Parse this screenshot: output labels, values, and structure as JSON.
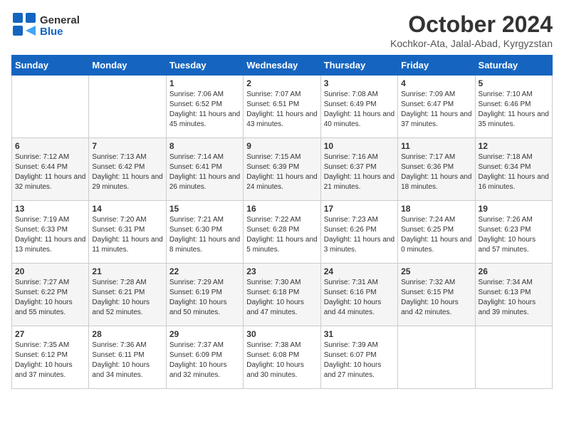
{
  "logo": {
    "text_general": "General",
    "text_blue": "Blue"
  },
  "header": {
    "month": "October 2024",
    "location": "Kochkor-Ata, Jalal-Abad, Kyrgyzstan"
  },
  "days_of_week": [
    "Sunday",
    "Monday",
    "Tuesday",
    "Wednesday",
    "Thursday",
    "Friday",
    "Saturday"
  ],
  "weeks": [
    [
      {
        "day": "",
        "info": ""
      },
      {
        "day": "",
        "info": ""
      },
      {
        "day": "1",
        "info": "Sunrise: 7:06 AM\nSunset: 6:52 PM\nDaylight: 11 hours and 45 minutes."
      },
      {
        "day": "2",
        "info": "Sunrise: 7:07 AM\nSunset: 6:51 PM\nDaylight: 11 hours and 43 minutes."
      },
      {
        "day": "3",
        "info": "Sunrise: 7:08 AM\nSunset: 6:49 PM\nDaylight: 11 hours and 40 minutes."
      },
      {
        "day": "4",
        "info": "Sunrise: 7:09 AM\nSunset: 6:47 PM\nDaylight: 11 hours and 37 minutes."
      },
      {
        "day": "5",
        "info": "Sunrise: 7:10 AM\nSunset: 6:46 PM\nDaylight: 11 hours and 35 minutes."
      }
    ],
    [
      {
        "day": "6",
        "info": "Sunrise: 7:12 AM\nSunset: 6:44 PM\nDaylight: 11 hours and 32 minutes."
      },
      {
        "day": "7",
        "info": "Sunrise: 7:13 AM\nSunset: 6:42 PM\nDaylight: 11 hours and 29 minutes."
      },
      {
        "day": "8",
        "info": "Sunrise: 7:14 AM\nSunset: 6:41 PM\nDaylight: 11 hours and 26 minutes."
      },
      {
        "day": "9",
        "info": "Sunrise: 7:15 AM\nSunset: 6:39 PM\nDaylight: 11 hours and 24 minutes."
      },
      {
        "day": "10",
        "info": "Sunrise: 7:16 AM\nSunset: 6:37 PM\nDaylight: 11 hours and 21 minutes."
      },
      {
        "day": "11",
        "info": "Sunrise: 7:17 AM\nSunset: 6:36 PM\nDaylight: 11 hours and 18 minutes."
      },
      {
        "day": "12",
        "info": "Sunrise: 7:18 AM\nSunset: 6:34 PM\nDaylight: 11 hours and 16 minutes."
      }
    ],
    [
      {
        "day": "13",
        "info": "Sunrise: 7:19 AM\nSunset: 6:33 PM\nDaylight: 11 hours and 13 minutes."
      },
      {
        "day": "14",
        "info": "Sunrise: 7:20 AM\nSunset: 6:31 PM\nDaylight: 11 hours and 11 minutes."
      },
      {
        "day": "15",
        "info": "Sunrise: 7:21 AM\nSunset: 6:30 PM\nDaylight: 11 hours and 8 minutes."
      },
      {
        "day": "16",
        "info": "Sunrise: 7:22 AM\nSunset: 6:28 PM\nDaylight: 11 hours and 5 minutes."
      },
      {
        "day": "17",
        "info": "Sunrise: 7:23 AM\nSunset: 6:26 PM\nDaylight: 11 hours and 3 minutes."
      },
      {
        "day": "18",
        "info": "Sunrise: 7:24 AM\nSunset: 6:25 PM\nDaylight: 11 hours and 0 minutes."
      },
      {
        "day": "19",
        "info": "Sunrise: 7:26 AM\nSunset: 6:23 PM\nDaylight: 10 hours and 57 minutes."
      }
    ],
    [
      {
        "day": "20",
        "info": "Sunrise: 7:27 AM\nSunset: 6:22 PM\nDaylight: 10 hours and 55 minutes."
      },
      {
        "day": "21",
        "info": "Sunrise: 7:28 AM\nSunset: 6:21 PM\nDaylight: 10 hours and 52 minutes."
      },
      {
        "day": "22",
        "info": "Sunrise: 7:29 AM\nSunset: 6:19 PM\nDaylight: 10 hours and 50 minutes."
      },
      {
        "day": "23",
        "info": "Sunrise: 7:30 AM\nSunset: 6:18 PM\nDaylight: 10 hours and 47 minutes."
      },
      {
        "day": "24",
        "info": "Sunrise: 7:31 AM\nSunset: 6:16 PM\nDaylight: 10 hours and 44 minutes."
      },
      {
        "day": "25",
        "info": "Sunrise: 7:32 AM\nSunset: 6:15 PM\nDaylight: 10 hours and 42 minutes."
      },
      {
        "day": "26",
        "info": "Sunrise: 7:34 AM\nSunset: 6:13 PM\nDaylight: 10 hours and 39 minutes."
      }
    ],
    [
      {
        "day": "27",
        "info": "Sunrise: 7:35 AM\nSunset: 6:12 PM\nDaylight: 10 hours and 37 minutes."
      },
      {
        "day": "28",
        "info": "Sunrise: 7:36 AM\nSunset: 6:11 PM\nDaylight: 10 hours and 34 minutes."
      },
      {
        "day": "29",
        "info": "Sunrise: 7:37 AM\nSunset: 6:09 PM\nDaylight: 10 hours and 32 minutes."
      },
      {
        "day": "30",
        "info": "Sunrise: 7:38 AM\nSunset: 6:08 PM\nDaylight: 10 hours and 30 minutes."
      },
      {
        "day": "31",
        "info": "Sunrise: 7:39 AM\nSunset: 6:07 PM\nDaylight: 10 hours and 27 minutes."
      },
      {
        "day": "",
        "info": ""
      },
      {
        "day": "",
        "info": ""
      }
    ]
  ]
}
